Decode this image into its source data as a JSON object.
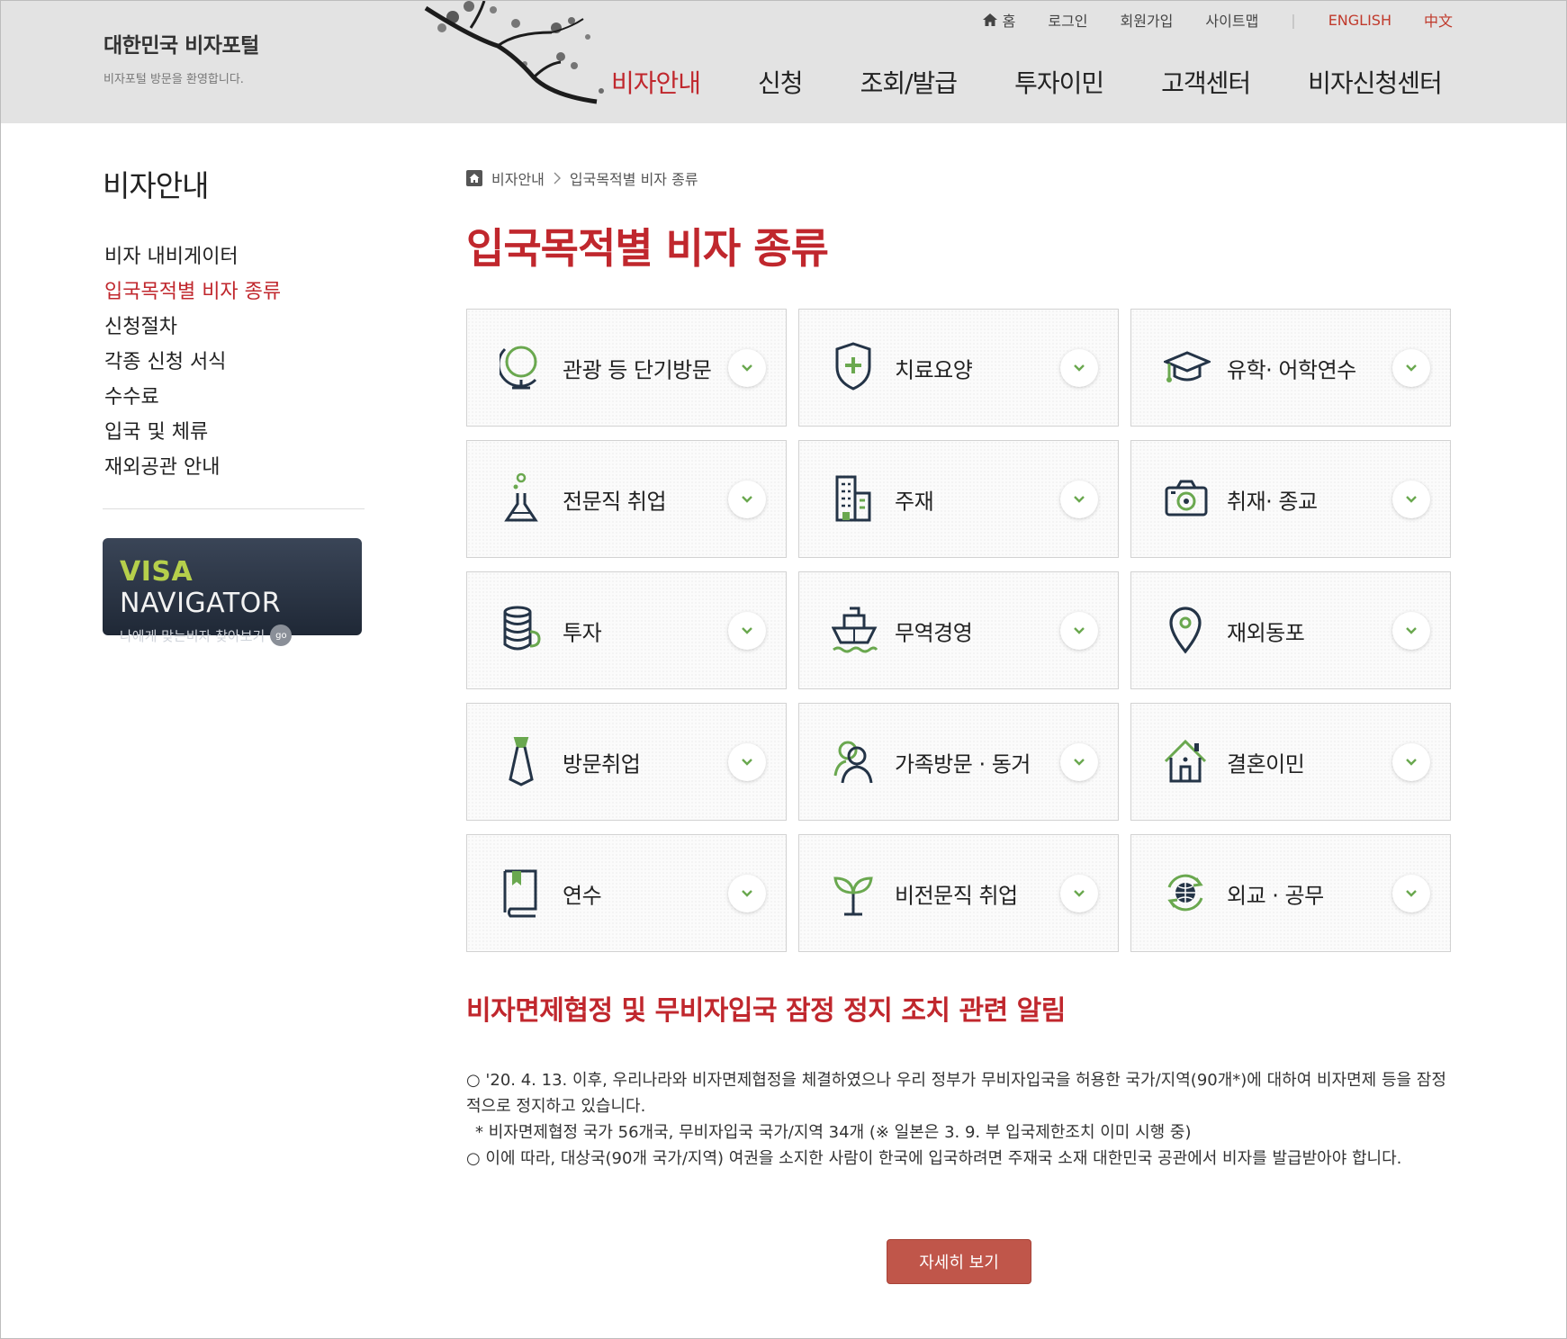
{
  "colors": {
    "accent": "#c0272d",
    "icon_green": "#6aa84f",
    "icon_navy": "#243447",
    "header_bg": "#e3e3e3"
  },
  "header": {
    "logo_title": "대한민국 비자포털",
    "logo_sub": "비자포털 방문을 환영합니다.",
    "util": {
      "home": "홈",
      "login": "로그인",
      "signup": "회원가입",
      "sitemap": "사이트맵",
      "separator": "|",
      "english": "ENGLISH",
      "chinese": "中文"
    },
    "gnb": [
      "비자안내",
      "신청",
      "조회/발급",
      "투자이민",
      "고객센터",
      "비자신청센터"
    ]
  },
  "lnb": {
    "title": "비자안내",
    "items": [
      "비자 내비게이터",
      "입국목적별 비자 종류",
      "신청절차",
      "각종 신청 서식",
      "수수료",
      "입국 및 체류",
      "재외공관 안내"
    ],
    "banner_title_1": "VISA",
    "banner_title_2": " NAVIGATOR",
    "banner_sub": "나에게 맞는비자 찾아보기",
    "banner_go": "go"
  },
  "content": {
    "breadcrumb": [
      "비자안내",
      "입국목적별 비자 종류"
    ],
    "title": "입국목적별 비자 종류",
    "cards": [
      {
        "label": "관광 등 단기방문",
        "icon": "globe-icon"
      },
      {
        "label": "치료요양",
        "icon": "medical-shield-icon"
      },
      {
        "label": "유학· 어학연수",
        "icon": "graduation-cap-icon"
      },
      {
        "label": "전문직 취업",
        "icon": "flask-icon"
      },
      {
        "label": "주재",
        "icon": "building-icon"
      },
      {
        "label": "취재· 종교",
        "icon": "camera-icon"
      },
      {
        "label": "투자",
        "icon": "coins-icon"
      },
      {
        "label": "무역경영",
        "icon": "ship-icon"
      },
      {
        "label": "재외동포",
        "icon": "location-pin-icon"
      },
      {
        "label": "방문취업",
        "icon": "necktie-icon"
      },
      {
        "label": "가족방문 · 동거",
        "icon": "family-icon"
      },
      {
        "label": "결혼이민",
        "icon": "house-icon"
      },
      {
        "label": "연수",
        "icon": "book-icon"
      },
      {
        "label": "비전문직 취업",
        "icon": "sprout-icon"
      },
      {
        "label": "외교 · 공무",
        "icon": "globe-arrows-icon"
      }
    ],
    "notice_title": "비자면제협정 및 무비자입국 잠정 정지 조치 관련 알림",
    "notice_lines": [
      "○ '20. 4. 13. 이후, 우리나라와 비자면제협정을 체결하였으나 우리 정부가 무비자입국을 허용한 국가/지역(90개*)에 대하여 비자면제 등을 잠정적으로 정지하고 있습니다.",
      "* 비자면제협정 국가 56개국, 무비자입국 국가/지역 34개 (※ 일본은 3. 9. 부 입국제한조치 이미 시행 중)",
      "○ 이에 따라, 대상국(90개 국가/지역) 여권을 소지한 사람이 한국에 입국하려면 주재국 소재 대한민국 공관에서 비자를 발급받아야 합니다."
    ],
    "more_button": "자세히 보기"
  }
}
